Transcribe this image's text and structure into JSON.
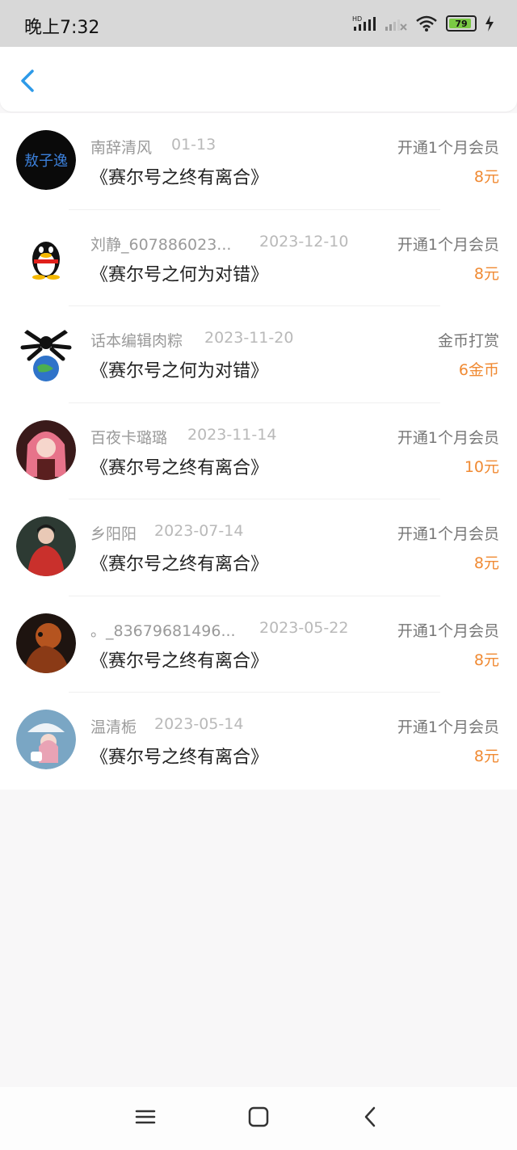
{
  "status_bar": {
    "time": "晚上7:32",
    "battery": "79"
  },
  "records": [
    {
      "name": "南辞清风",
      "date": "01-13",
      "book": "《赛尔号之终有离合》",
      "type": "开通1个月会员",
      "amount": "8元"
    },
    {
      "name": "刘静_607886023...",
      "date": "2023-12-10",
      "book": "《赛尔号之何为对错》",
      "type": "开通1个月会员",
      "amount": "8元"
    },
    {
      "name": "话本编辑肉粽",
      "date": "2023-11-20",
      "book": "《赛尔号之何为对错》",
      "type": "金币打赏",
      "amount": "6金币"
    },
    {
      "name": "百夜卡璐璐",
      "date": "2023-11-14",
      "book": "《赛尔号之终有离合》",
      "type": "开通1个月会员",
      "amount": "10元"
    },
    {
      "name": "乡阳阳",
      "date": "2023-07-14",
      "book": "《赛尔号之终有离合》",
      "type": "开通1个月会员",
      "amount": "8元"
    },
    {
      "name": "。_83679681496...",
      "date": "2023-05-22",
      "book": "《赛尔号之终有离合》",
      "type": "开通1个月会员",
      "amount": "8元"
    },
    {
      "name": "温清栀",
      "date": "2023-05-14",
      "book": "《赛尔号之终有离合》",
      "type": "开通1个月会员",
      "amount": "8元"
    }
  ]
}
